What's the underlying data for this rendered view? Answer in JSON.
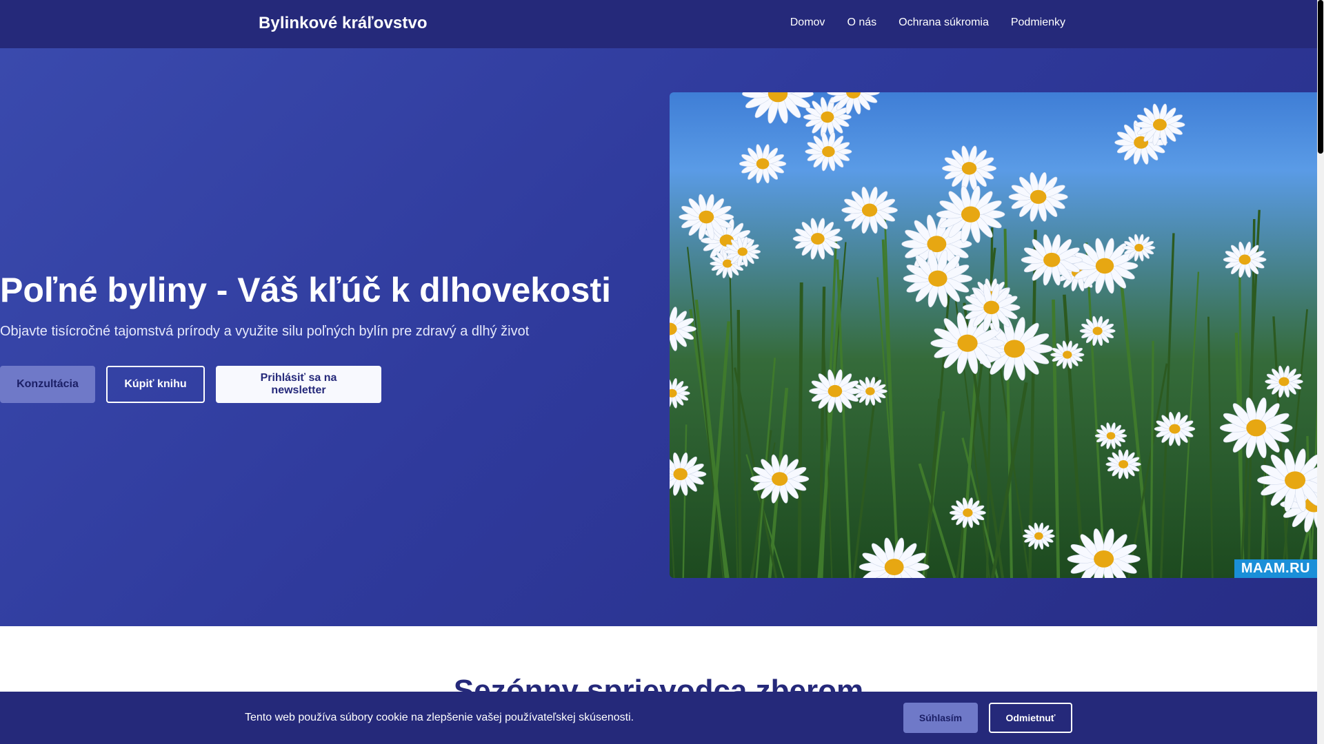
{
  "header": {
    "brand": "Bylinkové kráľovstvo",
    "nav": [
      "Domov",
      "O nás",
      "Ochrana súkromia",
      "Podmienky"
    ]
  },
  "hero": {
    "title": "Poľné byliny - Váš kľúč k dlhovekosti",
    "subtitle": "Objavte tisícročné tajomstvá prírody a využite silu poľných bylín pre zdravý a dlhý život",
    "buttons": {
      "consult": "Konzultácia",
      "book": "Kúpiť knihu",
      "newsletter": "Prihlásiť sa na newsletter"
    },
    "image_watermark": "MAAM.RU"
  },
  "section": {
    "title": "Sezónny sprievodca zberom"
  },
  "cookie": {
    "text": "Tento web používa súbory cookie na zlepšenie vašej používateľskej skúsenosti.",
    "accept": "Súhlasím",
    "decline": "Odmietnuť"
  },
  "colors": {
    "primary": "#25297a",
    "hero_gradient_start": "#3a4aad",
    "accent_button": "#6f79c8",
    "watermark": "#1a8fd8"
  }
}
